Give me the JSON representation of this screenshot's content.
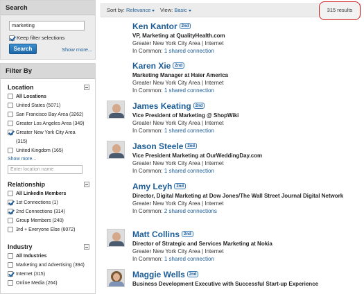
{
  "search": {
    "title": "Search",
    "keywords_value": "marketing",
    "keep_filters_label": "Keep filter selections",
    "keep_filters_checked": true,
    "search_button": "Search",
    "show_more": "Show more..."
  },
  "filters": {
    "title": "Filter By",
    "location": {
      "title": "Location",
      "items": [
        {
          "label": "All Locations",
          "checked": false,
          "bold": true
        },
        {
          "label": "United States (5071)",
          "checked": false
        },
        {
          "label": "San Francisco Bay Area (3262)",
          "checked": false
        },
        {
          "label": "Greater Los Angeles Area (349)",
          "checked": false
        },
        {
          "label": "Greater New York City Area",
          "checked": true
        },
        {
          "label": "(315)",
          "checked": false,
          "continuation": true
        },
        {
          "label": "United Kingdom (165)",
          "checked": false
        }
      ],
      "show_more": "Show more...",
      "input_placeholder": "Enter location name"
    },
    "relationship": {
      "title": "Relationship",
      "items": [
        {
          "label": "All LinkedIn Members",
          "checked": false,
          "bold": true
        },
        {
          "label": "1st Connections (1)",
          "checked": true
        },
        {
          "label": "2nd Connections (314)",
          "checked": true
        },
        {
          "label": "Group Members (240)",
          "checked": false
        },
        {
          "label": "3rd + Everyone Else (6072)",
          "checked": false
        }
      ]
    },
    "industry": {
      "title": "Industry",
      "items": [
        {
          "label": "All Industries",
          "checked": false,
          "bold": true
        },
        {
          "label": "Marketing and Advertising (394)",
          "checked": false
        },
        {
          "label": "Internet (315)",
          "checked": true
        },
        {
          "label": "Online Media (264)",
          "checked": false
        }
      ]
    }
  },
  "sortbar": {
    "sort_label": "Sort by:",
    "sort_value": "Relevance",
    "view_label": "View:",
    "view_value": "Basic",
    "results": "315 results"
  },
  "results": [
    {
      "name": "Ken Kantor",
      "degree": "2nd",
      "title": "VP, Marketing at QualityHealth.com",
      "location": "Greater New York City Area | Internet",
      "in_common_label": "In Common:",
      "in_common_link": "1 shared connection",
      "avatar": null
    },
    {
      "name": "Karen Xie",
      "degree": "2nd",
      "title": "Marketing Manager at Haier America",
      "location": "Greater New York City Area | Internet",
      "in_common_label": "In Common:",
      "in_common_link": "1 shared connection",
      "avatar": null
    },
    {
      "name": "James Keating",
      "degree": "2nd",
      "title": "Vice President of Marketing @ ShopWiki",
      "location": "Greater New York City Area | Internet",
      "in_common_label": "In Common:",
      "in_common_link": "1 shared connection",
      "avatar": "male"
    },
    {
      "name": "Jason Steele",
      "degree": "2nd",
      "title": "Vice President Marketing at OurWeddingDay.com",
      "location": "Greater New York City Area | Internet",
      "in_common_label": "In Common:",
      "in_common_link": "1 shared connection",
      "avatar": "male"
    },
    {
      "name": "Amy Leyh",
      "degree": "2nd",
      "title": "Director, Digital Marketing at Dow Jones/The Wall Street Journal Digital Network",
      "location": "Greater New York City Area | Internet",
      "in_common_label": "In Common:",
      "in_common_link": "2 shared connections",
      "avatar": null
    },
    {
      "name": "Matt Collins",
      "degree": "2nd",
      "title": "Director of Strategic and Services Marketing at Nokia",
      "location": "Greater New York City Area | Internet",
      "in_common_label": "In Common:",
      "in_common_link": "1 shared connection",
      "avatar": "male"
    },
    {
      "name": "Maggie Wells",
      "degree": "2nd",
      "title": "Business Development Executive with Successful Start-up Experience",
      "location": "",
      "in_common_label": "",
      "in_common_link": "",
      "avatar": "female"
    }
  ]
}
